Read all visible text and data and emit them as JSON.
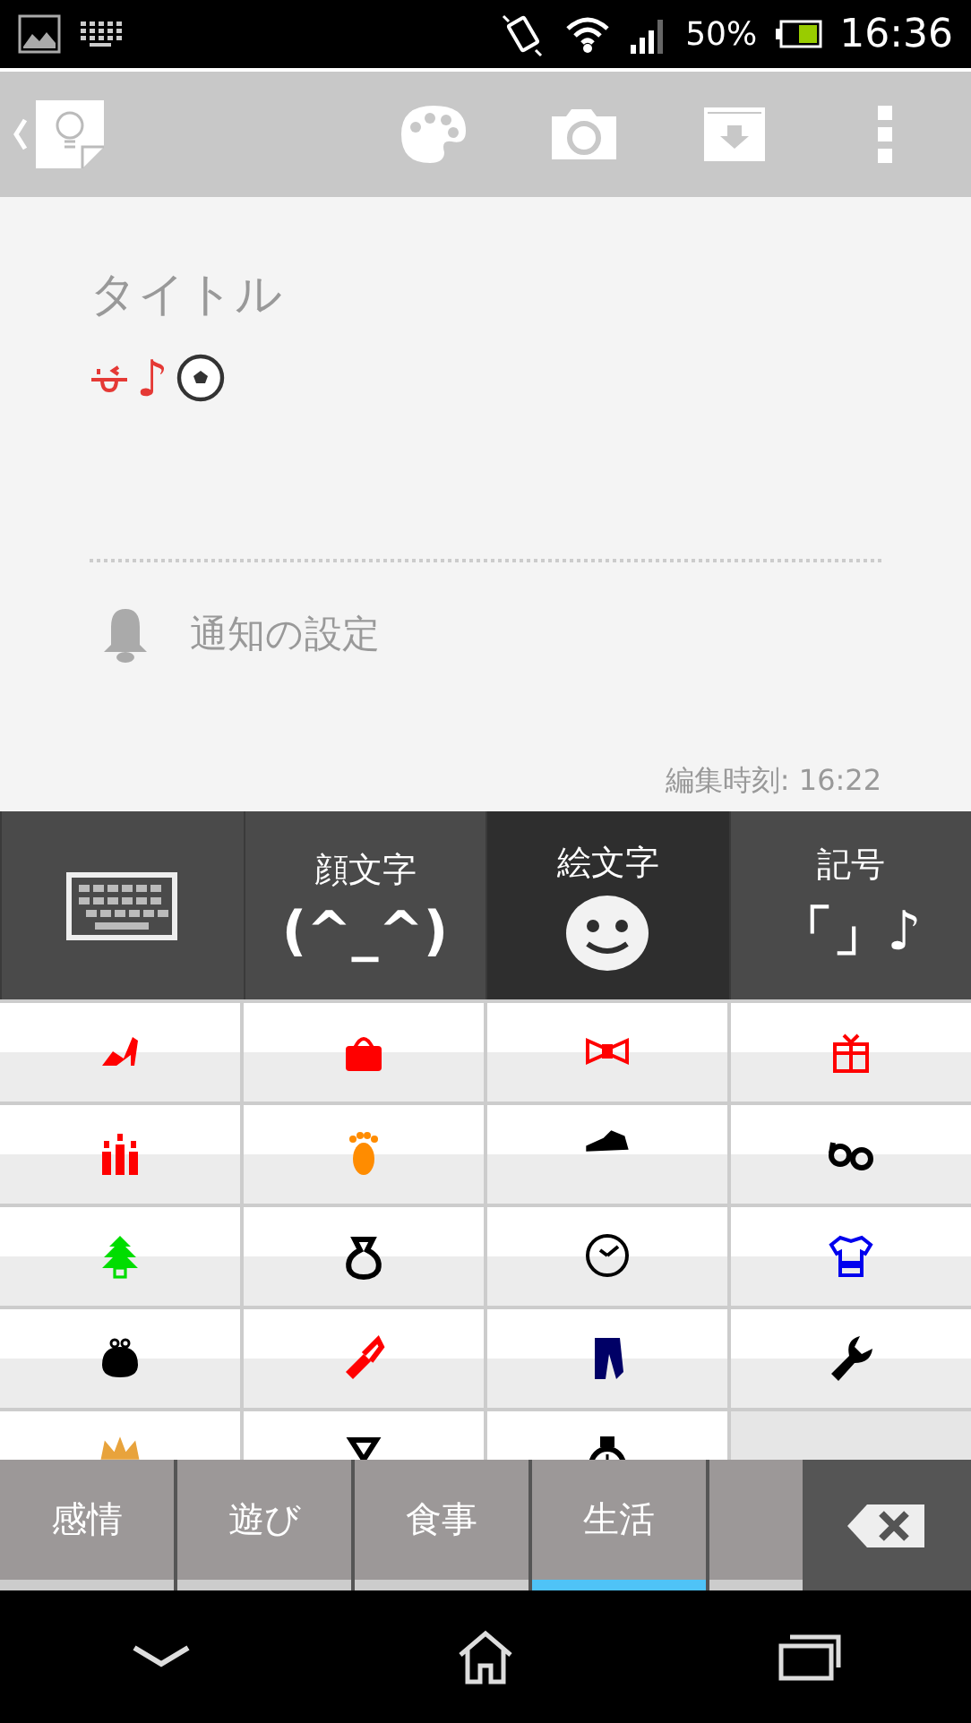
{
  "status_bar": {
    "battery": "50%",
    "time": "16:36"
  },
  "note": {
    "title_placeholder": "タイトル",
    "body": [
      {
        "kind": "face",
        "color": "#e53935"
      },
      {
        "kind": "text",
        "text": "♪",
        "color": "#e53935"
      },
      {
        "kind": "ball",
        "color": "#333333"
      }
    ],
    "reminder": "通知の設定",
    "edited": "編集時刻: 16:22"
  },
  "keyboard_tabs": [
    {
      "kind": "keyboard",
      "selected": false
    },
    {
      "kind": "kaomoji",
      "label": "顔文字",
      "glyph": "(^_^)",
      "selected": false
    },
    {
      "kind": "emoji",
      "label": "絵文字",
      "selected": true
    },
    {
      "kind": "symbol",
      "label": "記号",
      "glyph": "「」♪",
      "selected": false
    }
  ],
  "emoji_grid": [
    {
      "kind": "heel",
      "color": "#ff0000"
    },
    {
      "kind": "bag",
      "color": "#ff0000"
    },
    {
      "kind": "ribbon",
      "color": "#ff0000"
    },
    {
      "kind": "gift",
      "color": "#ff0000"
    },
    {
      "kind": "candles",
      "color": "#ff0000"
    },
    {
      "kind": "foot",
      "color": "#ff8c00"
    },
    {
      "kind": "sneaker",
      "color": "#000000"
    },
    {
      "kind": "glasses",
      "color": "#000000"
    },
    {
      "kind": "tree",
      "color": "#00dd00"
    },
    {
      "kind": "pouch",
      "color": "#000000"
    },
    {
      "kind": "clock",
      "color": "#000000"
    },
    {
      "kind": "shirt",
      "color": "#0000ee"
    },
    {
      "kind": "purse",
      "color": "#000000"
    },
    {
      "kind": "lipstick",
      "color": "#ff0000"
    },
    {
      "kind": "jeans",
      "color": "#000066"
    },
    {
      "kind": "wrench",
      "color": "#000000"
    },
    {
      "kind": "crown",
      "color": "#e8a33c"
    },
    {
      "kind": "hourglass",
      "color": "#000000"
    },
    {
      "kind": "stopwatch",
      "color": "#000000"
    },
    {
      "kind": "empty"
    }
  ],
  "categories": [
    {
      "label": "感情",
      "selected": false
    },
    {
      "label": "遊び",
      "selected": false
    },
    {
      "label": "食事",
      "selected": false
    },
    {
      "label": "生活",
      "selected": true
    },
    {
      "selected": false
    }
  ]
}
